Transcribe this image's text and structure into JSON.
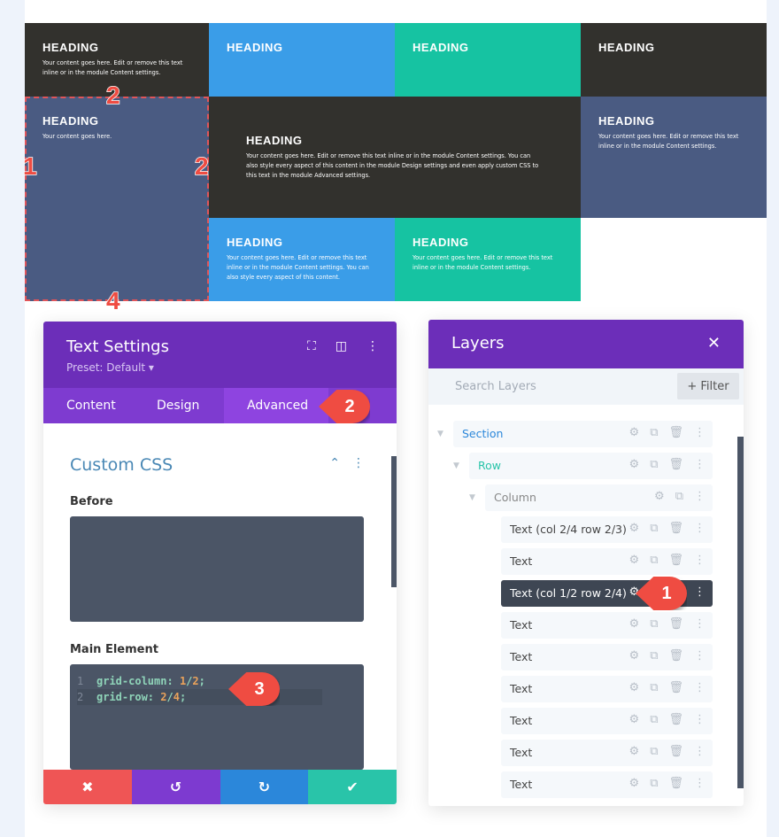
{
  "grid": {
    "cells": [
      {
        "heading": "HEADING",
        "text": "Your content goes here. Edit or remove this text inline or in the module Content settings."
      },
      {
        "heading": "HEADING",
        "text": ""
      },
      {
        "heading": "HEADING",
        "text": ""
      },
      {
        "heading": "HEADING",
        "text": ""
      },
      {
        "heading": "HEADING",
        "text": "Your content goes here."
      },
      {
        "heading": "HEADING",
        "text": "Your content goes here. Edit or remove this text inline or in the module Content settings. You can also style every aspect of this content in the module Design settings and even apply custom CSS to this text in the module Advanced settings."
      },
      {
        "heading": "HEADING",
        "text": "Your content goes here. Edit or remove this text inline or in the module Content settings."
      },
      {
        "heading": "HEADING",
        "text": "Your content goes here. Edit or remove this text inline or in the module Content settings. You can also style every aspect of this content."
      },
      {
        "heading": "HEADING",
        "text": "Your content goes here. Edit or remove this text inline or in the module Content settings."
      }
    ],
    "markers": {
      "top": "2",
      "left": "1",
      "right": "2",
      "bottom": "4"
    }
  },
  "settings": {
    "title": "Text Settings",
    "preset": "Preset: Default ▾",
    "tabs": [
      "Content",
      "Design",
      "Advanced"
    ],
    "section": "Custom CSS",
    "before_label": "Before",
    "main_label": "Main Element",
    "code": [
      {
        "n": "1",
        "prop": "grid-column",
        "a": "1",
        "b": "2"
      },
      {
        "n": "2",
        "prop": "grid-row",
        "a": "2",
        "b": "4"
      }
    ],
    "callouts": {
      "tab": "2",
      "code": "3"
    },
    "footer": {
      "cancel": "✖",
      "undo": "↺",
      "redo": "↻",
      "save": "✔"
    }
  },
  "layers": {
    "title": "Layers",
    "close": "✕",
    "search_placeholder": "Search Layers",
    "filter": "+ Filter",
    "items": [
      "Section",
      "Row",
      "Column",
      "Text (col 2/4 row 2/3)",
      "Text",
      "Text (col 1/2 row 2/4)",
      "Text",
      "Text",
      "Text",
      "Text",
      "Text",
      "Text"
    ],
    "callout": "1"
  },
  "colors": {
    "purple": "#6c2eb9",
    "red": "#ef5555",
    "blue": "#2b87da",
    "teal": "#29c4a9",
    "dark": "#32312d",
    "slate": "#4a5b82"
  }
}
